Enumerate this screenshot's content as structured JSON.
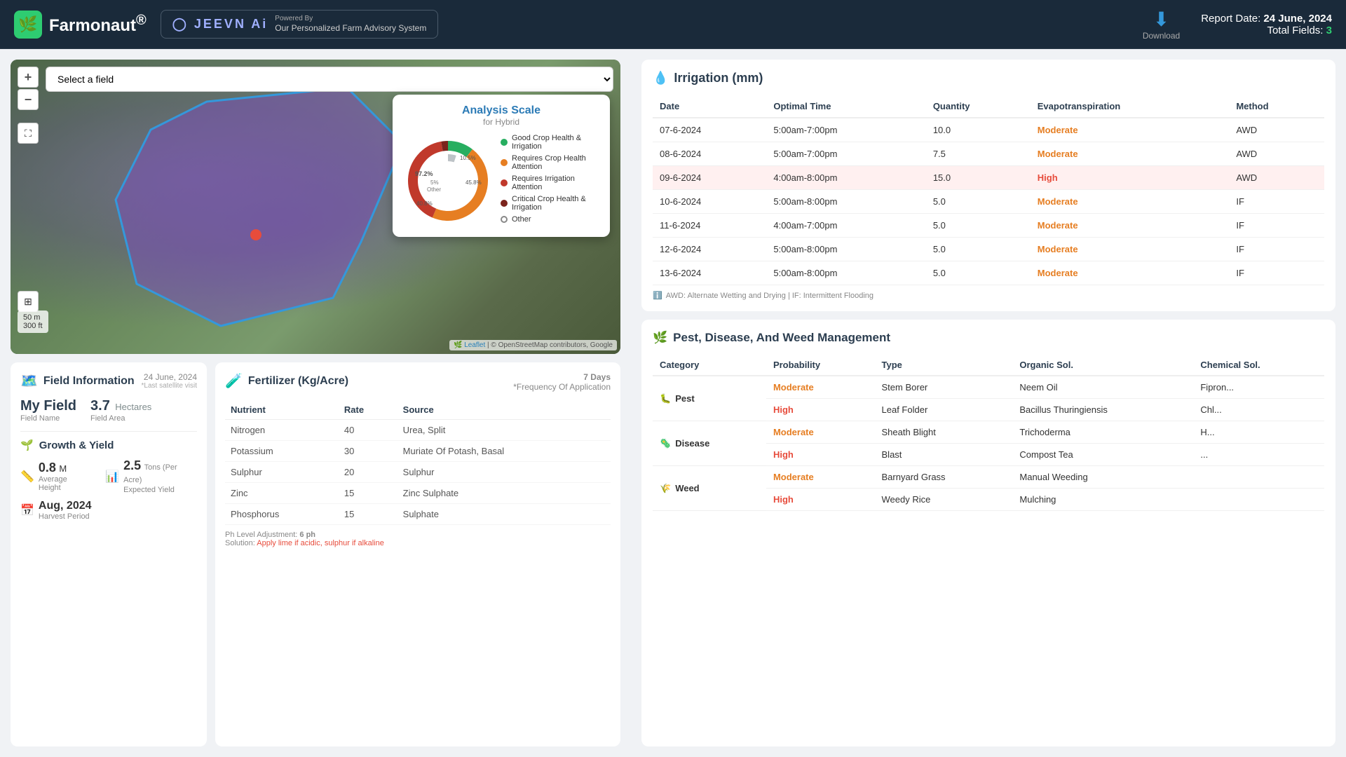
{
  "header": {
    "logo_text": "Farmonaut",
    "logo_reg": "®",
    "jeevn_label": "JEEVN Ai",
    "powered_by": "Powered By",
    "powered_desc": "Our Personalized Farm Advisory System",
    "download_label": "Download",
    "report_date_label": "Report Date:",
    "report_date": "24 June, 2024",
    "total_fields_label": "Total Fields:",
    "total_fields": "3"
  },
  "map": {
    "field_select_placeholder": "Select a field",
    "zoom_in": "+",
    "zoom_out": "−",
    "scale_m": "50 m",
    "scale_ft": "300 ft",
    "attribution_leaflet": "Leaflet",
    "attribution_osm": "© OpenStreetMap contributors, Google"
  },
  "analysis_scale": {
    "title": "Analysis Scale",
    "subtitle": "for Hybrid",
    "segments": [
      {
        "label": "Good Crop Health & Irrigation",
        "color": "#27ae60",
        "percent": 10.5
      },
      {
        "label": "Requires Crop Health Attention",
        "color": "#e67e22",
        "percent": 45.8
      },
      {
        "label": "Requires Irrigation Attention",
        "color": "#c0392b",
        "percent": 40.8
      },
      {
        "label": "Critical Crop Health & Irrigation",
        "color": "#922b21",
        "percent": 7.0
      },
      {
        "label": "Other",
        "color": "#bdc3c7",
        "percent": 5.0
      }
    ],
    "center_label_top": "97.2%",
    "center_label_mid": "10.5%",
    "center_label_bot": "45.8%",
    "label_other": "5%\nOther",
    "label_408": "40.8%"
  },
  "irrigation": {
    "title": "Irrigation (mm)",
    "icon": "💧",
    "columns": [
      "Date",
      "Optimal Time",
      "Quantity",
      "Evapotranspiration",
      "Method"
    ],
    "rows": [
      {
        "date": "07-6-2024",
        "time": "5:00am-7:00pm",
        "qty": "10.0",
        "evap": "Moderate",
        "method": "AWD",
        "highlight": false
      },
      {
        "date": "08-6-2024",
        "time": "5:00am-7:00pm",
        "qty": "7.5",
        "evap": "Moderate",
        "method": "AWD",
        "highlight": false
      },
      {
        "date": "09-6-2024",
        "time": "4:00am-8:00pm",
        "qty": "15.0",
        "evap": "High",
        "method": "AWD",
        "highlight": true
      },
      {
        "date": "10-6-2024",
        "time": "5:00am-8:00pm",
        "qty": "5.0",
        "evap": "Moderate",
        "method": "IF",
        "highlight": false
      },
      {
        "date": "11-6-2024",
        "time": "4:00am-7:00pm",
        "qty": "5.0",
        "evap": "Moderate",
        "method": "IF",
        "highlight": false
      },
      {
        "date": "12-6-2024",
        "time": "5:00am-8:00pm",
        "qty": "5.0",
        "evap": "Moderate",
        "method": "IF",
        "highlight": false
      },
      {
        "date": "13-6-2024",
        "time": "5:00am-8:00pm",
        "qty": "5.0",
        "evap": "Moderate",
        "method": "IF",
        "highlight": false
      }
    ],
    "note": "AWD: Alternate Wetting and Drying | IF: Intermittent Flooding"
  },
  "field_info": {
    "title": "Field Information",
    "icon": "🗺️",
    "date": "24 June, 2024",
    "last_visit": "*Last satellite visit",
    "field_name": "My Field",
    "field_name_label": "Field Name",
    "field_area_value": "3.7",
    "field_area_unit": "Hectares",
    "field_area_label": "Field Area",
    "growth_title": "Growth & Yield",
    "growth_icon": "🌱",
    "avg_height": "0.8",
    "avg_height_unit": "M",
    "avg_height_label": "Average Height",
    "expected_yield": "2.5",
    "expected_yield_unit": "Tons (Per Acre)",
    "expected_yield_label": "Expected Yield",
    "harvest_period": "Aug, 2024",
    "harvest_label": "Harvest Period"
  },
  "fertilizer": {
    "title": "Fertilizer (Kg/Acre)",
    "icon": "🧪",
    "days_label": "7 Days",
    "freq_label": "*Frequency Of Application",
    "columns": [
      "Nutrient",
      "Rate",
      "Source"
    ],
    "rows": [
      {
        "nutrient": "Nitrogen",
        "rate": "40",
        "source": "Urea, Split"
      },
      {
        "nutrient": "Potassium",
        "rate": "30",
        "source": "Muriate Of Potash, Basal"
      },
      {
        "nutrient": "Sulphur",
        "rate": "20",
        "source": "Sulphur"
      },
      {
        "nutrient": "Zinc",
        "rate": "15",
        "source": "Zinc Sulphate"
      },
      {
        "nutrient": "Phosphorus",
        "rate": "15",
        "source": "Sulphate"
      }
    ],
    "ph_label": "Ph Level Adjustment:",
    "ph_value": "6 ph",
    "solution_label": "Solution:",
    "solution_text": "Apply lime if acidic, sulphur if alkaline"
  },
  "pest": {
    "title": "Pest, Disease, And Weed Management",
    "icon": "🌿",
    "columns": [
      "Category",
      "Probability",
      "Type",
      "Organic Sol.",
      "Chemical Sol."
    ],
    "categories": [
      {
        "name": "Pest",
        "icon": "🐛",
        "rows": [
          {
            "prob": "Moderate",
            "type": "Stem Borer",
            "organic": "Neem Oil",
            "chemical": "Fipron..."
          },
          {
            "prob": "High",
            "type": "Leaf Folder",
            "organic": "Bacillus Thuringiensis",
            "chemical": "Chl..."
          }
        ]
      },
      {
        "name": "Disease",
        "icon": "🦠",
        "rows": [
          {
            "prob": "Moderate",
            "type": "Sheath Blight",
            "organic": "Trichoderma",
            "chemical": "H..."
          },
          {
            "prob": "High",
            "type": "Blast",
            "organic": "Compost Tea",
            "chemical": "..."
          }
        ]
      },
      {
        "name": "Weed",
        "icon": "🌾",
        "rows": [
          {
            "prob": "Moderate",
            "type": "Barnyard Grass",
            "organic": "Manual Weeding",
            "chemical": ""
          },
          {
            "prob": "High",
            "type": "Weedy Rice",
            "organic": "Mulching",
            "chemical": ""
          }
        ]
      }
    ]
  },
  "colors": {
    "accent_blue": "#2c7bb6",
    "accent_green": "#27ae60",
    "accent_orange": "#e67e22",
    "accent_red": "#e74c3c",
    "header_bg": "#1a2a3a",
    "moderate": "#e67e22",
    "high": "#e74c3c"
  }
}
